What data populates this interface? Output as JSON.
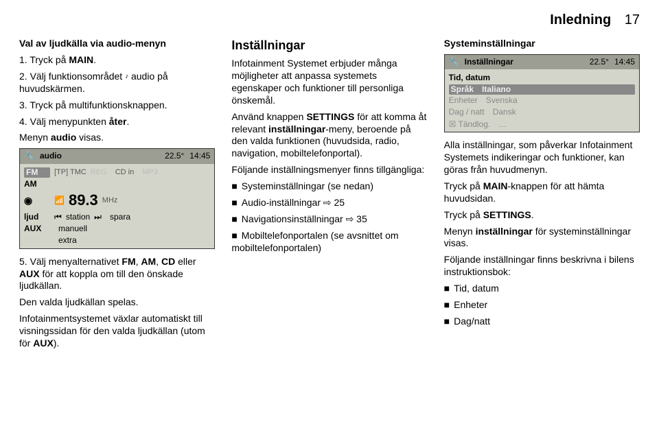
{
  "header": {
    "chapter": "Inledning",
    "page": "17"
  },
  "col1": {
    "heading": "Val av ljudkälla via audio-menyn",
    "s1_a": "1. Tryck på ",
    "s1_b": "MAIN",
    "s1_c": ".",
    "s2_a": "2. Välj funktionsområdet ",
    "s2_note": "♪",
    "s2_b": " audio på huvudskärmen.",
    "s3": "3. Tryck på multifunktionsknappen.",
    "s4_a": "4. Välj menypunkten ",
    "s4_b": "åter",
    "s4_c": ".",
    "menu_a": "Menyn ",
    "menu_b": "audio",
    "menu_c": " visas.",
    "lcd": {
      "wrench": "🔧",
      "title": "audio",
      "temp": "22.5°",
      "time": "14:45",
      "r1_l": "FM",
      "r1_m1": "[TP]  TMC",
      "r1_m2": "REG",
      "r1_r1": "CD in",
      "r1_r2": "MP3",
      "r2_l": "AM",
      "r3_l": "◉",
      "r3_icon": "📶",
      "r3_freq": "89.3",
      "r3_unit": "MHz",
      "r4_l": "ljud",
      "r4_prev": "⏮",
      "r4_m": "station",
      "r4_next": "⏭",
      "r4_r": "spara",
      "r5_l": "AUX",
      "r5_r": "manuell",
      "r6_r": "extra"
    },
    "s5_a": "5. Välj menyalternativet ",
    "s5_b": "FM",
    "s5_c": ", ",
    "s5_d": "AM",
    "s5_e": ", ",
    "s5_f": "CD",
    "s5_g": " eller ",
    "s5_h": "AUX",
    "s5_i": " för att koppla om till den önskade ljudkällan.",
    "p1": "Den valda ljudkällan spelas.",
    "p2_a": "Infotainmentsystemet växlar automatiskt till visningssidan för den valda ljudkällan (utom för ",
    "p2_b": "AUX",
    "p2_c": ")."
  },
  "col2": {
    "heading": "Inställningar",
    "p1": "Infotainment Systemet erbjuder många möjligheter att anpassa systemets egenskaper och funktioner till personliga önskemål.",
    "p2_a": "Använd knappen ",
    "p2_b": "SETTINGS",
    "p2_c": " för att komma åt relevant ",
    "p2_d": "inställningar",
    "p2_e": "-meny, beroende på den valda funktionen (huvudsida, radio, navigation, mobiltelefonportal).",
    "p3": "Följande inställningsmenyer finns tillgängliga:",
    "li1": "Systeminställningar (se nedan)",
    "li2_a": "Audio-inställningar ",
    "li2_b": "⇨ 25",
    "li3_a": "Navigationsinställningar ",
    "li3_b": "⇨ 35",
    "li4": "Mobiltelefonportalen (se avsnittet om mobiltelefonportalen)"
  },
  "col3": {
    "heading": "Systeminställningar",
    "lcd": {
      "wrench": "🔧",
      "title": "Inställningar",
      "temp": "22.5°",
      "time": "14:45",
      "r1_l": "Tid, datum",
      "r2_l": "Språk",
      "r2_r": "Italiano",
      "r3_l": "Enheter",
      "r3_r": "Svenska",
      "r4_l": "Dag / natt",
      "r4_r": "Dansk",
      "r5_l": "☒ Tändlog.",
      "r5_r": "…"
    },
    "p1": "Alla inställningar, som påverkar Infotainment Systemets indikeringar och funktioner, kan göras från huvudmenyn.",
    "p2_a": "Tryck på ",
    "p2_b": "MAIN",
    "p2_c": "-knappen för att hämta huvudsidan.",
    "p3_a": "Tryck på ",
    "p3_b": "SETTINGS",
    "p3_c": ".",
    "p4_a": "Menyn ",
    "p4_b": "inställningar",
    "p4_c": " för systeminställningar visas.",
    "p5": "Följande inställningar finns beskrivna i bilens instruktionsbok:",
    "li1": "Tid, datum",
    "li2": "Enheter",
    "li3": "Dag/natt"
  }
}
